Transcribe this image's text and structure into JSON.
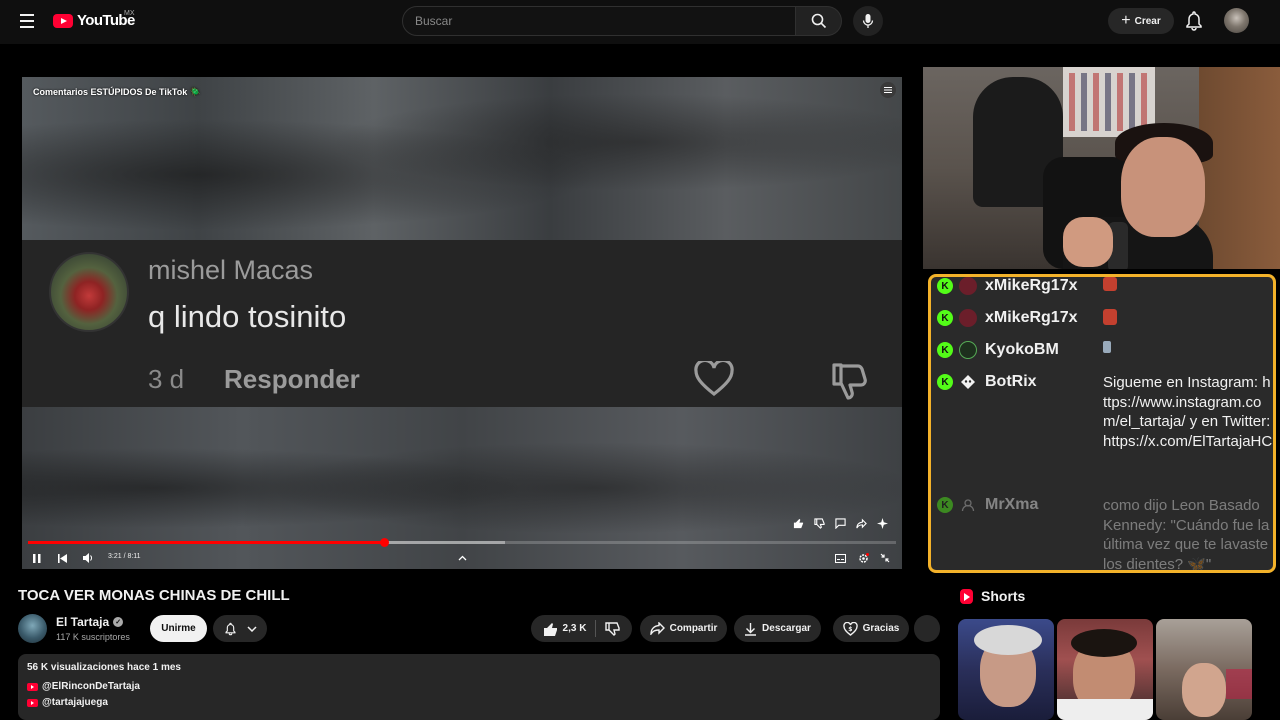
{
  "header": {
    "logo_text": "YouTube",
    "region": "MX",
    "search_placeholder": "Buscar",
    "create_label": "Crear"
  },
  "player": {
    "video_title": "Comentarios ESTÚPIDOS De TikTok 🪲",
    "comment": {
      "user": "mishel Macas",
      "text": "q lindo tosinito",
      "age": "3 d",
      "reply_label": "Responder"
    },
    "time_display": "3:21 / 8:11",
    "progress_played_fraction": 0.41,
    "progress_loaded_fraction": 0.55
  },
  "chat": {
    "messages": [
      {
        "user": "xMikeRg17x",
        "text": "",
        "avatar_color": "#6b1e2a",
        "faded": false
      },
      {
        "user": "xMikeRg17x",
        "text": "",
        "avatar_color": "#6b1e2a",
        "faded": false
      },
      {
        "user": "KyokoBM",
        "text": "",
        "avatar_color": "#1d2f1d",
        "faded": false
      },
      {
        "user": "BotRix",
        "text": "Sigueme en Instagram: https://www.instagram.com/el_tartaja/ y en Twitter: https://x.com/ElTartajaHC",
        "avatar_color": "#f1f1f1",
        "faded": false
      },
      {
        "user": "MrXma",
        "text": "como dijo Leon Basado Kennedy: \"Cuándo fue la última vez que te lavaste los dientes? 🦋\"",
        "avatar_color": "#777777",
        "faded": true
      }
    ],
    "border_color": "#f3b22a",
    "badge_color": "#53fc18"
  },
  "video": {
    "title": "TOCA VER MONAS CHINAS DE CHILL",
    "channel_name": "El Tartaja",
    "subscribers": "117 K suscriptores",
    "join_label": "Unirme",
    "like_count": "2,3 K",
    "share_label": "Compartir",
    "download_label": "Descargar",
    "thanks_label": "Gracias"
  },
  "description": {
    "stats": "56 K visualizaciones  hace 1 mes",
    "links": [
      "@ElRinconDeTartaja",
      "@tartajajuega"
    ]
  },
  "shorts": {
    "heading": "Shorts"
  }
}
